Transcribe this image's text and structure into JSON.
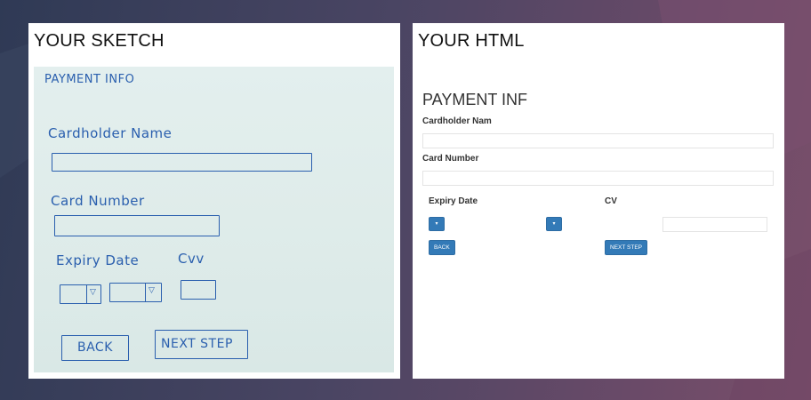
{
  "sketch_panel": {
    "title": "YOUR SKETCH",
    "sketch": {
      "heading": "PAYMENT  INFO",
      "cardholder_label": "Cardholder  Name",
      "card_number_label": "Card  Number",
      "expiry_label": "Expiry  Date",
      "cvv_label": "Cvv",
      "back_label": "BACK",
      "next_label": "NEXT  STEP"
    }
  },
  "html_panel": {
    "title": "YOUR HTML",
    "form": {
      "heading": "PAYMENT INF",
      "cardholder_label": "Cardholder Nam",
      "cardholder_value": "",
      "card_number_label": "Card Number",
      "card_number_value": "",
      "expiry_label": "Expiry Date",
      "cvv_label": "CV",
      "cvv_value": "",
      "expiry_month_caret": "▾",
      "expiry_year_caret": "▾",
      "back_label": "BACK",
      "next_label": "NEXT STEP"
    }
  },
  "colors": {
    "button_blue": "#337ab7",
    "ink_blue": "#2a5fae"
  },
  "icons": [
    "chevron-down-icon"
  ]
}
